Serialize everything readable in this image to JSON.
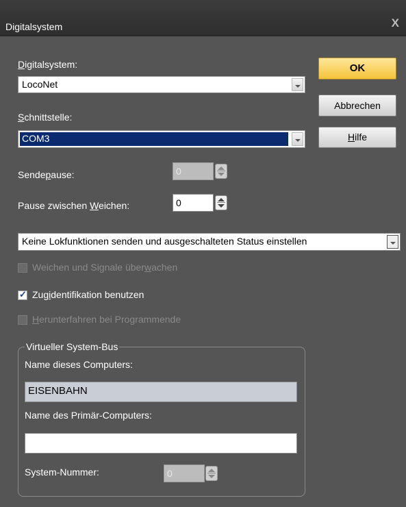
{
  "window": {
    "title": "Digitalsystem",
    "close_glyph": "X"
  },
  "digitalsystem": {
    "label_u": "D",
    "label_rest": "igitalsystem:",
    "value": "LocoNet"
  },
  "schnittstelle": {
    "label_u": "S",
    "label_rest": "chnittstelle:",
    "value": "COM3"
  },
  "buttons": {
    "ok": "OK",
    "cancel": "Abbrechen",
    "help_u": "H",
    "help_rest": "ilfe"
  },
  "sendepause": {
    "label_pre": "Sende",
    "label_u": "p",
    "label_post": "ause:",
    "value": "0"
  },
  "pause_weichen": {
    "label_pre": "Pause zwischen ",
    "label_u": "W",
    "label_post": "eichen:",
    "value": "0"
  },
  "mode_select": {
    "value": "Keine Lokfunktionen senden und ausgeschalteten Status einstellen"
  },
  "checkboxes": {
    "weichen_pre": "Weichen und Signale über",
    "weichen_u": "w",
    "weichen_post": "achen",
    "zug_pre": "Zug",
    "zug_u": "i",
    "zug_post": "dentifikation benutzen",
    "zug_checked": true,
    "herunter_u": "H",
    "herunter_rest": "erunterfahren bei Programmende"
  },
  "bus": {
    "legend": "Virtueller System-Bus",
    "name_label": "Name dieses Computers:",
    "name_value": "EISENBAHN",
    "primary_label": "Name des Primär-Computers:",
    "primary_value": "",
    "number_label": "System-Nummer:",
    "number_value": "0"
  }
}
